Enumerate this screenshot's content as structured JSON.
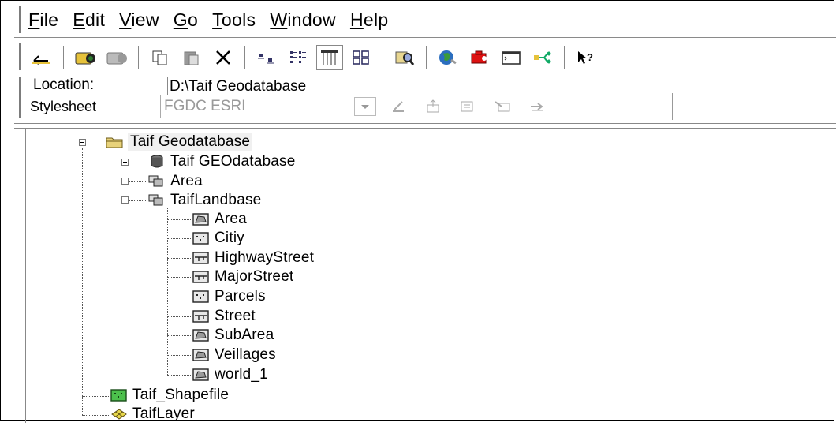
{
  "menu": [
    {
      "label": "File",
      "key": "F",
      "rest": "ile"
    },
    {
      "label": "Edit",
      "key": "E",
      "rest": "dit"
    },
    {
      "label": "View",
      "key": "V",
      "rest": "iew"
    },
    {
      "label": "Go",
      "key": "G",
      "rest": "o"
    },
    {
      "label": "Tools",
      "key": "T",
      "rest": "ools"
    },
    {
      "label": "Window",
      "key": "W",
      "rest": "indow"
    },
    {
      "label": "Help",
      "key": "H",
      "rest": "elp"
    }
  ],
  "location": {
    "label": "Location:",
    "value": "D:\\Taif Geodatabase"
  },
  "stylesheet": {
    "label": "Stylesheet",
    "value": "FGDC ESRI"
  },
  "tree": {
    "root": "Taif Geodatabase",
    "geodatabase": "Taif GEOdatabase",
    "area_dataset": "Area",
    "landbase": "TaifLandbase",
    "classes": [
      "Area",
      "Citiy",
      "HighwayStreet",
      "MajorStreet",
      "Parcels",
      "Street",
      "SubArea",
      "Veillages",
      "world_1"
    ],
    "shapefile": "Taif_Shapefile",
    "layer": "TaifLayer"
  }
}
